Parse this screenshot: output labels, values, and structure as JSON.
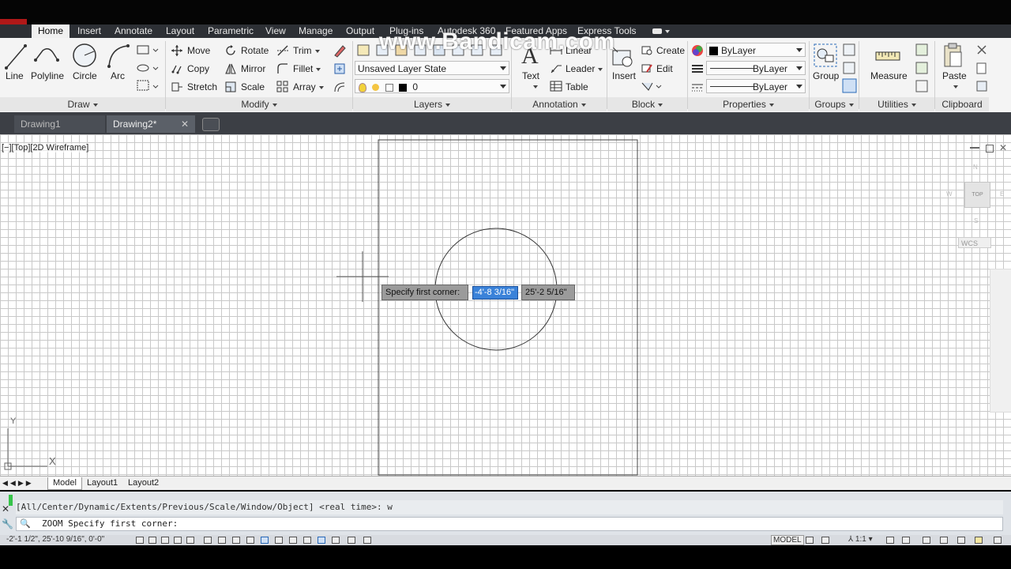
{
  "ribbon_tabs": [
    "Home",
    "Insert",
    "Annotate",
    "Layout",
    "Parametric",
    "View",
    "Manage",
    "Output",
    "Plug-ins",
    "Autodesk 360",
    "Featured Apps",
    "Express Tools"
  ],
  "watermark": "www.Bandicam.com",
  "draw": {
    "line": "Line",
    "polyline": "Polyline",
    "circle": "Circle",
    "arc": "Arc",
    "title": "Draw"
  },
  "modify": {
    "move": "Move",
    "rotate": "Rotate",
    "trim": "Trim",
    "copy": "Copy",
    "mirror": "Mirror",
    "fillet": "Fillet",
    "stretch": "Stretch",
    "scale": "Scale",
    "array": "Array",
    "title": "Modify"
  },
  "layers": {
    "state": "Unsaved Layer State",
    "current": "0",
    "title": "Layers"
  },
  "annotation": {
    "text": "Text",
    "linear": "Linear",
    "leader": "Leader",
    "table": "Table",
    "title": "Annotation"
  },
  "block": {
    "insert": "Insert",
    "create": "Create",
    "edit": "Edit",
    "title": "Block"
  },
  "properties": {
    "color": "ByLayer",
    "lineweight": "ByLayer",
    "linetype": "ByLayer",
    "title": "Properties"
  },
  "groups": {
    "group": "Group",
    "title": "Groups"
  },
  "utilities": {
    "measure": "Measure",
    "title": "Utilities"
  },
  "clipboard": {
    "paste": "Paste",
    "title": "Clipboard"
  },
  "file_tabs": [
    "Drawing1",
    "Drawing2*"
  ],
  "view_label": "[−][Top][2D Wireframe]",
  "viewcube": {
    "face": "TOP",
    "wcs": "WCS",
    "north": "N",
    "west": "W",
    "east": "E",
    "south": "S"
  },
  "dynamic_input": {
    "prompt": "Specify first corner:",
    "x": "-4'-8 3/16\"",
    "y": "25'-2 5/16\""
  },
  "layout_tabs": [
    "Model",
    "Layout1",
    "Layout2"
  ],
  "command_history": "[All/Center/Dynamic/Extents/Previous/Scale/Window/Object] <real time>: w",
  "command_line": "ZOOM Specify first corner:",
  "status": {
    "coords": "-2'-1 1/2\", 25'-10 9/16\", 0'-0\"",
    "model": "MODEL",
    "scale": "1:1"
  },
  "colors": {
    "ribbon_bg": "#f4f4f4",
    "tab_bar": "#2d3035",
    "grid": "#c9c9c9",
    "highlight": "#3a82d9"
  }
}
